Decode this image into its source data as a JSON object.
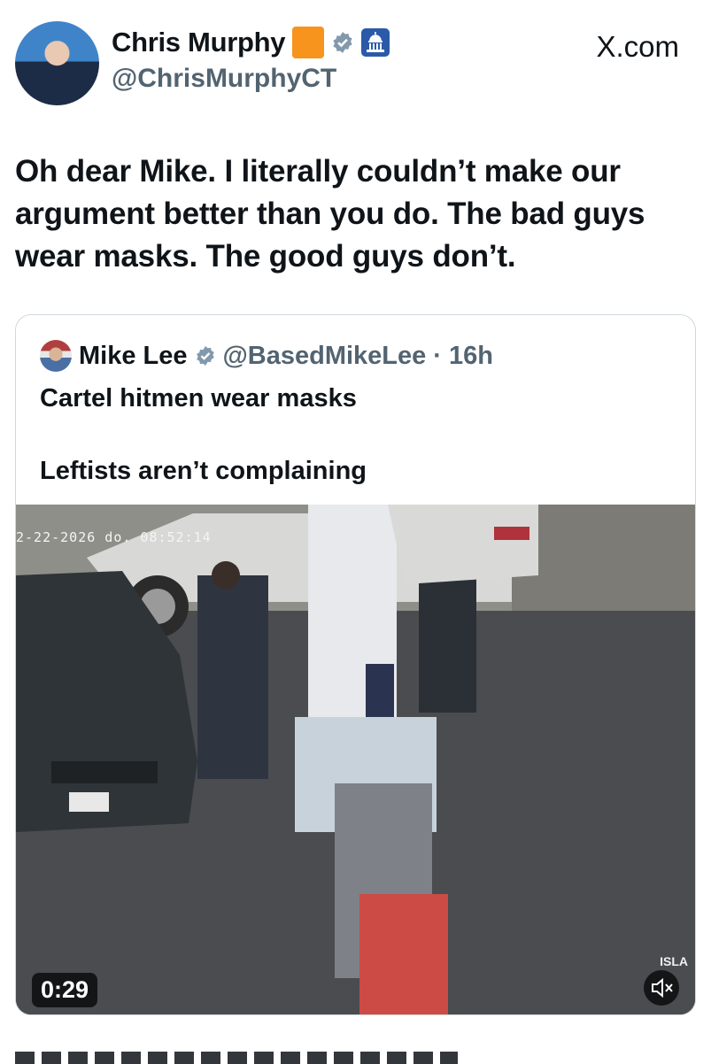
{
  "author": {
    "name": "Chris Murphy",
    "handle": "@ChrisMurphyCT",
    "badges": [
      "orange-square-emoji",
      "verified-badge-icon",
      "capitol-building-icon"
    ]
  },
  "site": "X.com",
  "tweet": {
    "text": "Oh dear Mike. I literally couldn’t make our argument better than you do. The bad guys wear masks. The good guys don’t."
  },
  "quoted": {
    "name": "Mike Lee",
    "handle": "@BasedMikeLee",
    "separator": "·",
    "time": "16h",
    "line1": "Cartel hitmen wear masks",
    "line2": "Leftists aren’t complaining",
    "video": {
      "duration": "0:29",
      "camera_timestamp": "2-22-2026 do.  08:52:14",
      "camera_brand": "ISLA",
      "muted": true
    }
  },
  "colors": {
    "text": "#0f1419",
    "secondary": "#536471",
    "border": "#cfd9de",
    "verified": "#8299ad",
    "brand_orange": "#f7941d"
  }
}
